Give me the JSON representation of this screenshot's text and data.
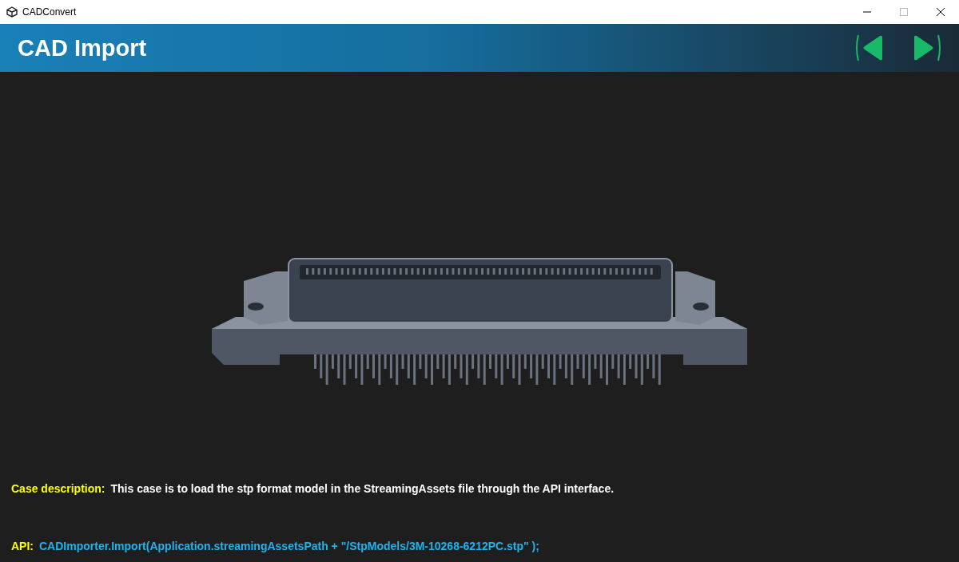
{
  "window": {
    "title": "CADConvert"
  },
  "header": {
    "title": "CAD Import"
  },
  "info": [
    {
      "kind": "description",
      "label": "Case description:",
      "text": "This case is to load the stp format model in the StreamingAssets file through the API interface."
    },
    {
      "kind": "api",
      "label": "API:",
      "text": "CADImporter.Import(Application.streamingAssetsPath + \"/StpModels/3M-10268-6212PC.stp\" );"
    }
  ]
}
